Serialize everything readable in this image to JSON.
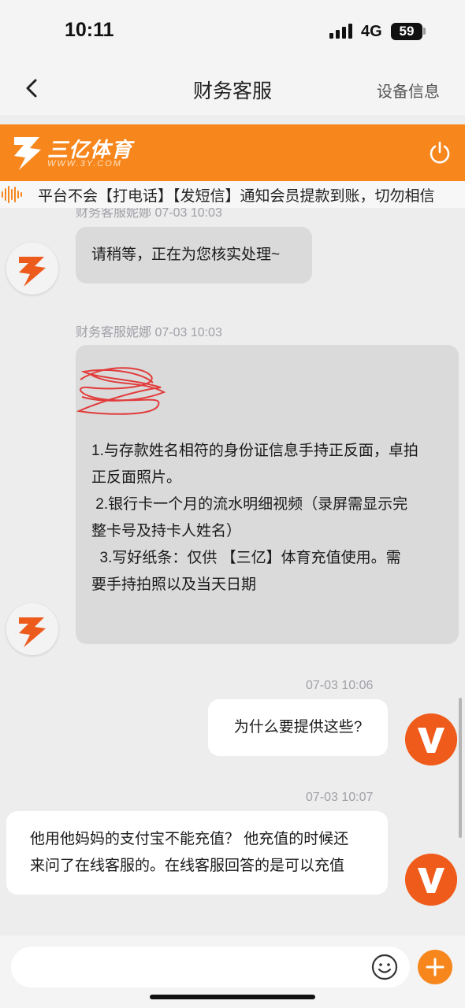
{
  "status_bar": {
    "time": "10:11",
    "network": "4G",
    "battery": "59"
  },
  "nav": {
    "title": "财务客服",
    "right_action": "设备信息"
  },
  "brand": {
    "name": "三亿体育",
    "url": "WWW.3Y.COM",
    "accent_color": "#f7861c"
  },
  "notice": {
    "text": "平台不会【打电话】【发短信】通知会员提款到账，切勿相信"
  },
  "messages": [
    {
      "side": "agent",
      "sender_line": "财务客服妮娜  07-03 10:03",
      "text": "请稍等，正在为您核实处理~"
    },
    {
      "side": "agent",
      "sender_line": "财务客服妮娜  07-03 10:03",
      "lines": [
        "1.与存款姓名相符的身份证信息手持正反面，卓拍",
        "正反面照片。",
        " 2.银行卡一个月的流水明细视频（录屏需显示完",
        "整卡号及持卡人姓名）",
        "  3.写好纸条：仅供 【三亿】体育充值使用。需",
        "要手持拍照以及当天日期"
      ]
    },
    {
      "side": "user",
      "time": "07-03 10:06",
      "text": "为什么要提供这些?"
    },
    {
      "side": "user",
      "time": "07-03 10:07",
      "lines": [
        "他用他妈妈的支付宝不能充值？ 他充值的时候还",
        "来问了在线客服的。在线客服回答的是可以充值"
      ]
    }
  ],
  "input": {
    "placeholder": ""
  },
  "icons": {
    "back": "chevron-left-icon",
    "power": "power-icon",
    "notice": "sound-wave-icon",
    "emoji": "emoji-icon",
    "plus": "plus-icon"
  }
}
